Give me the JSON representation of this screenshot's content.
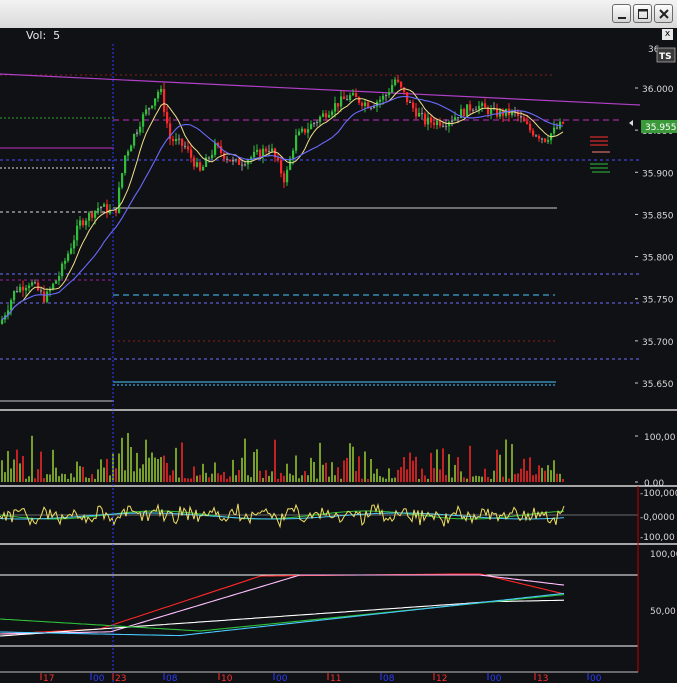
{
  "window": {
    "buttons": [
      "minimize",
      "maximize",
      "close"
    ]
  },
  "infobar": {
    "vol_label": "Vol:",
    "vol_value": "5",
    "close_glyph": "x"
  },
  "price_panel": {
    "corner_label": "36",
    "ts_badge": "TS",
    "last_price": "35.955",
    "y_ticks": [
      "36.000",
      "35.950",
      "35.900",
      "35.850",
      "35.800",
      "35.750",
      "35.700",
      "35.650"
    ]
  },
  "volume_panel": {
    "y_ticks": [
      "100,00",
      "0,00"
    ]
  },
  "osc1_panel": {
    "y_ticks": [
      "-100,000",
      "-0,0000",
      "-100,00"
    ]
  },
  "osc2_panel": {
    "y_ticks": [
      "100,00",
      "50,00"
    ]
  },
  "time_axis": {
    "labels": [
      {
        "t": "17",
        "c": "#ff3030"
      },
      {
        "t": "00",
        "c": "#2a3cff"
      },
      {
        "t": "23",
        "c": "#ff3030"
      },
      {
        "t": "08",
        "c": "#2a3cff"
      },
      {
        "t": "10",
        "c": "#ff3030"
      },
      {
        "t": "00",
        "c": "#2a3cff"
      },
      {
        "t": "11",
        "c": "#ff3030"
      },
      {
        "t": "08",
        "c": "#2a3cff"
      },
      {
        "t": "12",
        "c": "#ff3030"
      },
      {
        "t": "00",
        "c": "#2a3cff"
      },
      {
        "t": "13",
        "c": "#ff3030"
      },
      {
        "t": "00",
        "c": "#2a3cff"
      }
    ]
  },
  "colors": {
    "background": "#101114",
    "grid": "#ffffff",
    "up": "#2fbf3a",
    "down": "#ff2828",
    "neutral": "#9a9a9a",
    "trend": "#b040c8",
    "ma_fast": "#f0e08a",
    "ma_slow": "#6a6aff",
    "support": "#8888ff",
    "cyan": "#48c8ff"
  }
}
